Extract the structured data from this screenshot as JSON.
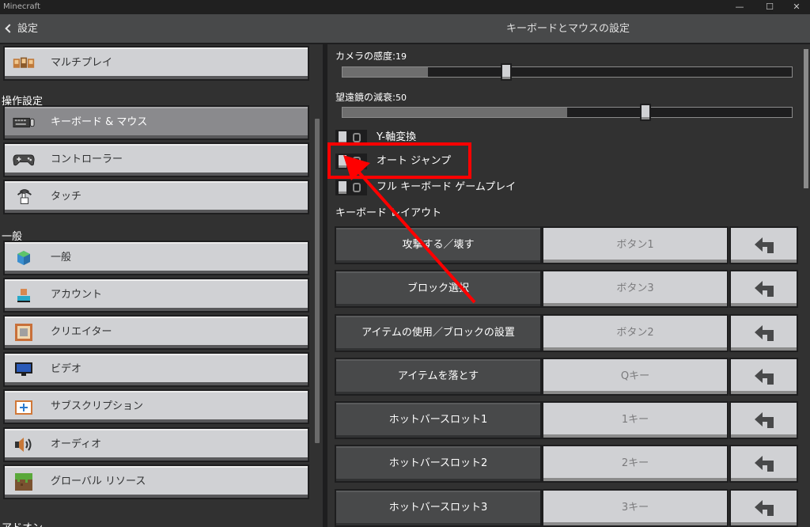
{
  "window": {
    "title": "Minecraft",
    "controls": [
      "—",
      "☐",
      "✕"
    ]
  },
  "header": {
    "back_label": "設定",
    "title": "キーボードとマウスの設定"
  },
  "sidebar": {
    "top_item": {
      "label": "マルチプレイ",
      "icon": "multiplayer-icon"
    },
    "sections": [
      {
        "title": "操作設定",
        "items": [
          {
            "label": "キーボード & マウス",
            "icon": "keyboard-mouse-icon",
            "active": true
          },
          {
            "label": "コントローラー",
            "icon": "controller-icon",
            "active": false
          },
          {
            "label": "タッチ",
            "icon": "touch-icon",
            "active": false
          }
        ]
      },
      {
        "title": "一般",
        "items": [
          {
            "label": "一般",
            "icon": "globe-icon"
          },
          {
            "label": "アカウント",
            "icon": "account-icon"
          },
          {
            "label": "クリエイター",
            "icon": "creator-icon"
          },
          {
            "label": "ビデオ",
            "icon": "monitor-icon"
          },
          {
            "label": "サブスクリプション",
            "icon": "subscription-icon"
          },
          {
            "label": "オーディオ",
            "icon": "speaker-icon"
          },
          {
            "label": "グローバル リソース",
            "icon": "grass-block-icon"
          }
        ]
      },
      {
        "title": "アドオン"
      }
    ]
  },
  "settings": {
    "sliders": [
      {
        "label": "カメラの感度:",
        "value": "19",
        "fraction": 0.19
      },
      {
        "label": "望遠鏡の減衰:",
        "value": "50",
        "fraction": 0.5
      }
    ],
    "toggles": [
      {
        "label": "Y-軸変換",
        "on": false
      },
      {
        "label": "オート ジャンプ",
        "on": false
      },
      {
        "label": "フル キーボード ゲームプレイ",
        "on": false
      }
    ]
  },
  "keyboard_layout": {
    "title": "キーボード レイアウト",
    "bindings": [
      {
        "action": "攻撃する／壊す",
        "key": "ボタン1"
      },
      {
        "action": "ブロック選択",
        "key": "ボタン3"
      },
      {
        "action": "アイテムの使用／ブロックの設置",
        "key": "ボタン2"
      },
      {
        "action": "アイテムを落とす",
        "key": "Qキー"
      },
      {
        "action": "ホットバースロット1",
        "key": "1キー"
      },
      {
        "action": "ホットバースロット2",
        "key": "2キー"
      },
      {
        "action": "ホットバースロット3",
        "key": "3キー"
      }
    ]
  },
  "colors": {
    "annotation": "#ff0000",
    "button": "#d0d1d4",
    "panel": "#313131",
    "header": "#48494a"
  }
}
